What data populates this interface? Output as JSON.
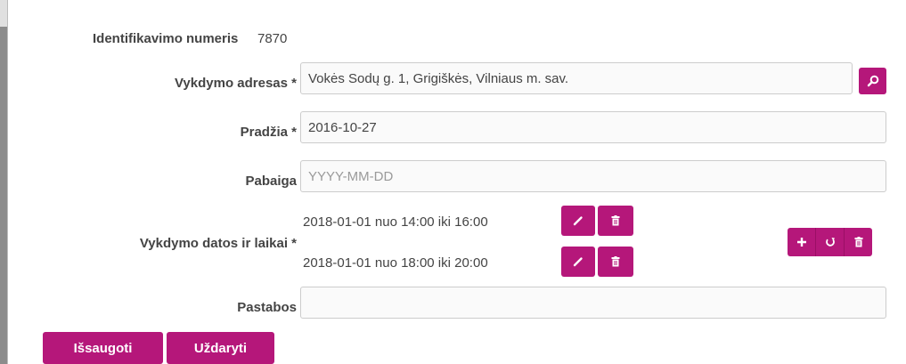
{
  "form": {
    "id_label": "Identifikavimo numeris",
    "id_value": "7870",
    "address_label": "Vykdymo adresas *",
    "address_value": "Vokės Sodų g. 1, Grigiškės, Vilniaus m. sav.",
    "start_label": "Pradžia *",
    "start_value": "2016-10-27",
    "end_label": "Pabaiga",
    "end_placeholder": "YYYY-MM-DD",
    "schedule_label": "Vykdymo datos ir laikai *",
    "schedule_items": [
      {
        "text": "2018-01-01 nuo 14:00 iki 16:00"
      },
      {
        "text": "2018-01-01 nuo 18:00 iki 20:00"
      }
    ],
    "notes_label": "Pastabos",
    "notes_value": ""
  },
  "actions": {
    "save_label": "Išsaugoti",
    "close_label": "Uždaryti"
  },
  "icons": {
    "address_search": "search-icon",
    "slot_edit": "pencil-icon",
    "slot_delete": "trash-icon",
    "add": "plus-icon",
    "refresh": "refresh-icon",
    "delete_all": "trash-icon"
  },
  "colors": {
    "accent": "#b5177a",
    "accent_dark": "#9b0f66",
    "field_border": "#cccccc",
    "text": "#444444"
  }
}
